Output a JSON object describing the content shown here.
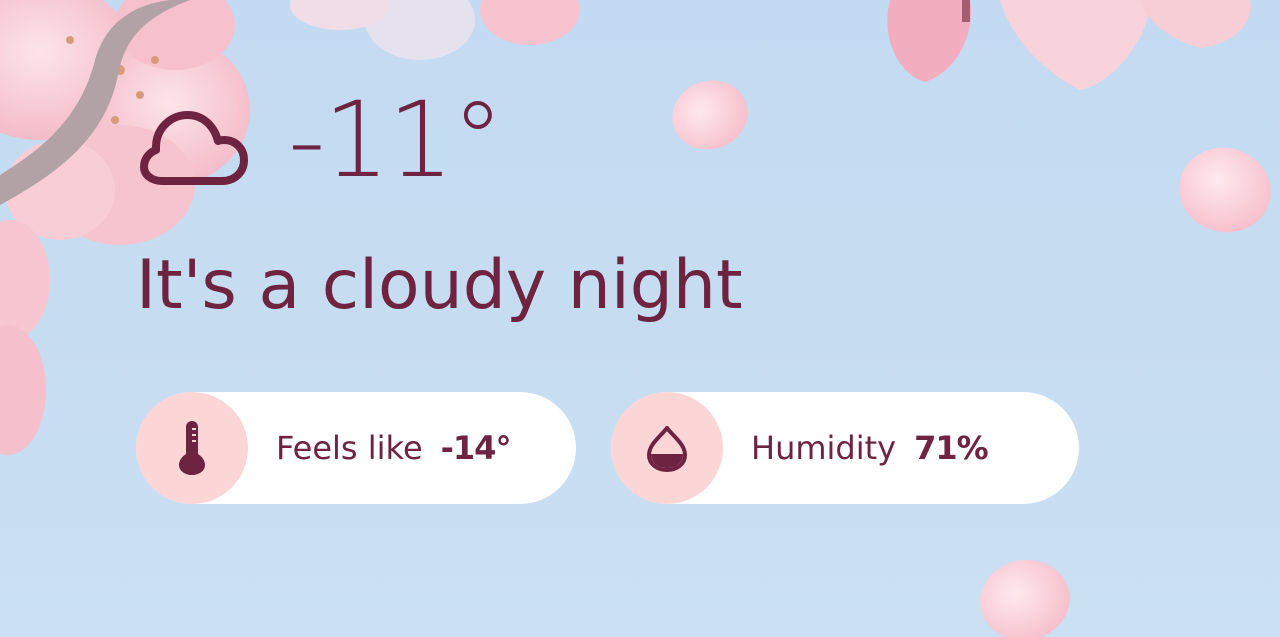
{
  "weather": {
    "icon": "cloud-icon",
    "temperature": "-11°",
    "condition": "It's a cloudy night"
  },
  "details": {
    "feels_like": {
      "icon": "thermometer-icon",
      "label": "Feels like",
      "value": "-14°"
    },
    "humidity": {
      "icon": "droplet-icon",
      "label": "Humidity",
      "value": "71%"
    }
  },
  "colors": {
    "text": "#6e2341",
    "sky": "#c6dcf1",
    "icon_bg": "#fcd5d7",
    "pill_bg": "#ffffff",
    "blossom": "#f7c3ce"
  }
}
